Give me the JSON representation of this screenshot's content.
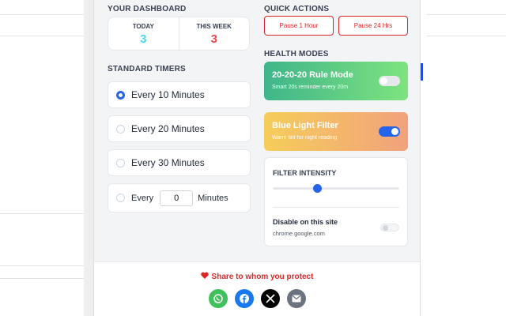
{
  "dashboard": {
    "label": "YOUR DASHBOARD",
    "today_label": "TODAY",
    "today_value": "3",
    "week_label": "THIS WEEK",
    "week_value": "3"
  },
  "timers": {
    "label": "STANDARD TIMERS",
    "options": [
      {
        "label": "Every 10 Minutes",
        "selected": true
      },
      {
        "label": "Every 20 Minutes",
        "selected": false
      },
      {
        "label": "Every 30 Minutes",
        "selected": false
      }
    ],
    "custom": {
      "prefix": "Every",
      "value": "0",
      "suffix": "Minutes"
    }
  },
  "quick_actions": {
    "label": "QUICK ACTIONS",
    "pause_1h": "Pause 1 Hour",
    "pause_24h": "Pause 24 Hrs"
  },
  "health": {
    "label": "HEALTH MODES",
    "rule_title": "20-20-20 Rule Mode",
    "rule_sub": "Smart 20s reminder every 20m",
    "rule_enabled": false,
    "blue_title": "Blue Light Filter",
    "blue_sub": "Warm tint for night reading",
    "blue_enabled": true
  },
  "filter": {
    "intensity_label": "FILTER INTENSITY",
    "intensity_fraction": 0.35,
    "disable_label": "Disable on this site",
    "site": "chrome.google.com",
    "disable_enabled": false
  },
  "footer": {
    "share_text": "Share to whom you protect",
    "socials": [
      "whatsapp-icon",
      "facebook-icon",
      "x-icon",
      "email-icon"
    ]
  },
  "colors": {
    "today": "#4dd6ea",
    "week": "#e5484d",
    "accent": "#2563eb",
    "danger": "#dc2626"
  }
}
